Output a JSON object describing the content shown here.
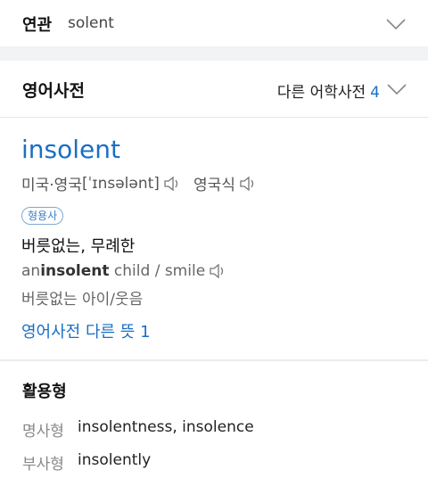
{
  "related": {
    "label": "연관",
    "term": "solent"
  },
  "dictionary": {
    "title": "영어사전",
    "other_dicts_label": "다른 어학사전",
    "other_dicts_count": "4"
  },
  "entry": {
    "headword": "insolent",
    "pron_region": "미국·영국",
    "pron_ipa": "[ˈɪnsələnt]",
    "pron_region2": "영국식",
    "pos": "형용사",
    "meaning": "버릇없는, 무례한",
    "example_pre": "an ",
    "example_bold": "insolent",
    "example_post": " child / smile",
    "example_translation": "버릇없는 아이/웃음",
    "more_link": "영어사전 다른 뜻 1"
  },
  "forms": {
    "title": "활용형",
    "items": [
      {
        "label": "명사형",
        "value": "insolentness, insolence"
      },
      {
        "label": "부사형",
        "value": "insolently"
      }
    ]
  },
  "colors": {
    "link": "#1a6fc4",
    "separator": "#f2f3f5"
  },
  "icons": [
    "chevron-down-icon",
    "speaker-icon"
  ]
}
